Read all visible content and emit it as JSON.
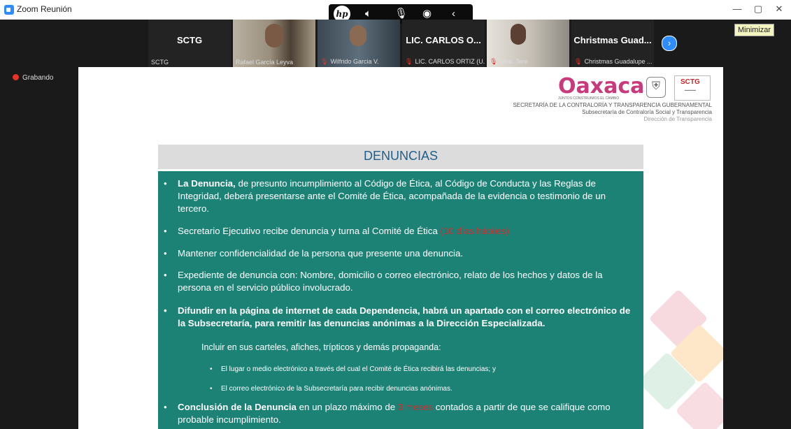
{
  "window": {
    "title": "Zoom Reunión",
    "tooltip": "Minimizar",
    "minimize_glyph": "—",
    "maximize_glyph": "▢",
    "close_glyph": "✕"
  },
  "toolbar": {
    "brand": "hp",
    "icons": [
      "speaker-icon",
      "microphone-icon",
      "broadcast-icon",
      "collapse-arrow-icon"
    ]
  },
  "participants": [
    {
      "name": "SCTG",
      "label": "SCTG",
      "video": false,
      "muted": false
    },
    {
      "name": "",
      "label": "Rafael García Leyva",
      "video": true,
      "muted": false
    },
    {
      "name": "",
      "label": "Wilfrido Garcia V.",
      "video": true,
      "muted": true
    },
    {
      "name": "LIC. CARLOS O...",
      "label": "LIC. CARLOS ORTIZ (U...",
      "video": false,
      "muted": true
    },
    {
      "name": "",
      "label": "Mtra. Tere",
      "video": true,
      "muted": true
    },
    {
      "name": "Christmas Guad...",
      "label": "Christmas Guadalupe ...",
      "video": false,
      "muted": true
    }
  ],
  "recording": "Grabando",
  "slide": {
    "logo_text": "Oaxaca",
    "logo_tagline": "JUNTOS CONSTRUIMOS EL CAMBIO",
    "sctg_badge": "SCTG",
    "dept_line1": "SECRETARÍA DE LA CONTRALORÍA Y TRANSPARENCIA GUBERNAMENTAL",
    "dept_line2": "Subsecretaría de Contraloría Social y Transparencia",
    "dept_line3": "Dirección de Transparencia",
    "header": "DENUNCIAS",
    "b1_strong": "La Denuncia,",
    "b1_rest": " de presunto incumplimiento al Código de Ética, al Código de Conducta y las Reglas de Integridad, deberá presentarse ante el Comité de Ética, acompañada de la evidencia o testimonio de un tercero.",
    "b2_text": "Secretario Ejecutivo recibe denuncia y turna al Comité de Ética ",
    "b2_red": "(10 días hábiles)",
    "b3": "Mantener confidencialidad de la persona que presente una denuncia.",
    "b4": "Expediente de denuncia con: Nombre, domicilio o correo electrónico, relato de los hechos y datos de la persona en el servicio público involucrado.",
    "b5": "Difundir en la página de internet de cada Dependencia, habrá un apartado con el correo electrónico de la Subsecretaría, para remitir las denuncias anónimas a la Dirección Especializada.",
    "include": "Incluir en sus carteles, afiches, trípticos y demás propaganda:",
    "sub1": "El lugar o medio electrónico a través del cual el Comité de Ética recibirá las denuncias; y",
    "sub2": "El correo electrónico de la Subsecretaría para recibir denuncias anónimas.",
    "b6_strong": "Conclusión de la Denuncia",
    "b6_mid": " en un plazo máximo de ",
    "b6_red": "3 meses",
    "b6_rest": " contados a partir de que se califique como probable incumplimiento."
  },
  "colors": {
    "teal": "#1d8276",
    "accent_blue": "#2d8cff",
    "alert_red": "#d62b2b"
  }
}
